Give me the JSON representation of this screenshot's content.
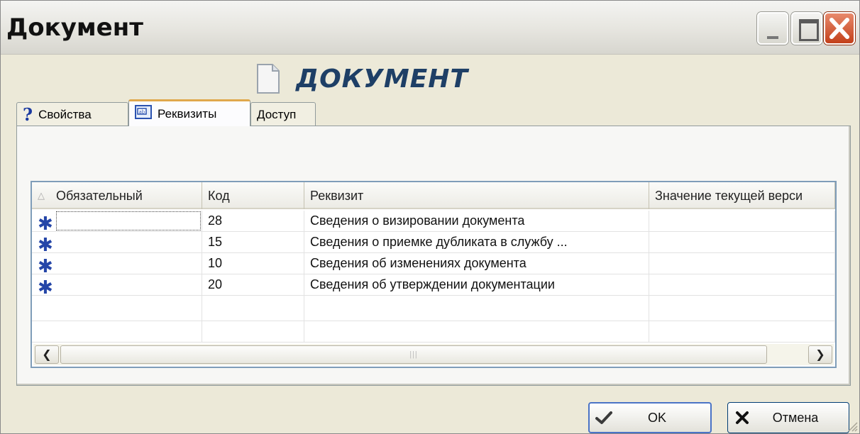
{
  "window": {
    "title": "Документ"
  },
  "header": {
    "title": "ДОКУМЕНТ"
  },
  "tabs": [
    {
      "label": "Свойства",
      "icon": "help-icon",
      "active": false
    },
    {
      "label": "Реквизиты",
      "icon": "form-icon",
      "active": true
    },
    {
      "label": "Доступ",
      "icon": "",
      "active": false
    }
  ],
  "grid": {
    "columns": [
      "Обязательный",
      "Код",
      "Реквизит",
      "Значение текущей верси"
    ],
    "rows": [
      {
        "required": "✱",
        "code": "28",
        "name": "Сведения о визировании документа",
        "value": ""
      },
      {
        "required": "✱",
        "code": "15",
        "name": "Сведения о приемке дубликата в службу ...",
        "value": ""
      },
      {
        "required": "✱",
        "code": "10",
        "name": "Сведения об изменениях документа",
        "value": ""
      },
      {
        "required": "✱",
        "code": "20",
        "name": "Сведения об утверждении документации",
        "value": ""
      }
    ]
  },
  "buttons": {
    "ok": "OK",
    "cancel": "Отмена"
  },
  "colors": {
    "accent_title": "#1e3f66",
    "asterisk": "#2546a8",
    "close_button": "#c3401a"
  }
}
